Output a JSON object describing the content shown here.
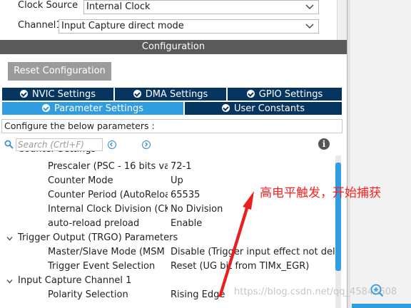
{
  "top": {
    "clock_source_label": "Clock Source",
    "clock_source_value": "Internal Clock",
    "channel1_label": "Channel1",
    "channel1_value": "Input Capture direct mode"
  },
  "config": {
    "header": "Configuration",
    "reset_button": "Reset Configuration",
    "tabs_row1": [
      "NVIC Settings",
      "DMA Settings",
      "GPIO Settings"
    ],
    "tabs_row2": [
      "Parameter Settings",
      "User Constants"
    ],
    "active_tab": "Parameter Settings",
    "configure_text": "Configure the below parameters :",
    "search_placeholder": "Search (Crtl+F)"
  },
  "params": {
    "cut_header": "Counter Settings",
    "counter_rows": [
      {
        "name": "Prescaler (PSC - 16 bits va...",
        "value": "72-1"
      },
      {
        "name": "Counter Mode",
        "value": "Up"
      },
      {
        "name": "Counter Period (AutoReloa...",
        "value": "65535"
      },
      {
        "name": "Internal Clock Division (CKD)",
        "value": "No Division"
      },
      {
        "name": "auto-reload preload",
        "value": "Enable"
      }
    ],
    "trgo_header": "Trigger Output (TRGO) Parameters",
    "trgo_rows": [
      {
        "name": "Master/Slave Mode (MSM ...",
        "value": "Disable (Trigger input effect not delay..."
      },
      {
        "name": "Trigger Event Selection",
        "value": "Reset (UG bit from TIMx_EGR)"
      }
    ],
    "ic_header": "Input Capture Channel 1",
    "ic_rows": [
      {
        "name": "Polarity Selection",
        "value": "Rising Edge"
      }
    ]
  },
  "annotation": {
    "text": "高电平触发，开始捕获",
    "color": "#ff2020"
  },
  "watermark": "https://blog.csdn.net/qq_45846608",
  "colors": {
    "tab_dark": "#06355f",
    "tab_active": "#2f9de0",
    "header_bar": "#5a5a5a",
    "reset_button": "#9b9b9b"
  },
  "icons": [
    "chevron-down-icon",
    "check-circle-icon",
    "search-icon",
    "prev-icon",
    "next-icon",
    "info-icon",
    "expand-arrow-icon",
    "zoom-in-icon"
  ]
}
